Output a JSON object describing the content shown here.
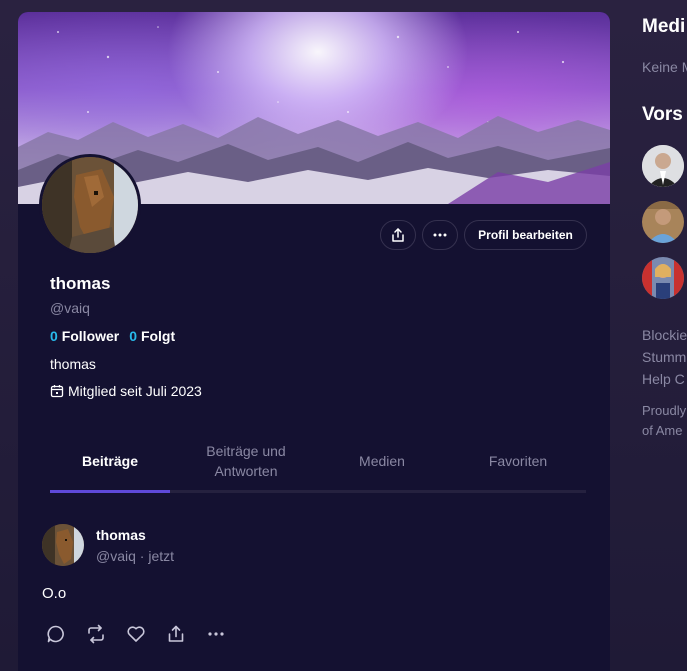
{
  "profile": {
    "name": "thomas",
    "handle": "@vaiq",
    "followers_count": "0",
    "followers_label": "Follower",
    "following_count": "0",
    "following_label": "Folgt",
    "bio": "thomas",
    "joined": "Mitglied seit Juli 2023"
  },
  "actions": {
    "edit_profile": "Profil bearbeiten",
    "share_icon": "share-icon",
    "more_icon": "more-horizontal-icon"
  },
  "tabs": [
    {
      "label": "Beiträge",
      "active": true
    },
    {
      "label": "Beiträge und Antworten",
      "active": false
    },
    {
      "label": "Medien",
      "active": false
    },
    {
      "label": "Favoriten",
      "active": false
    }
  ],
  "post": {
    "author": "thomas",
    "meta": "@vaiq · jetzt",
    "text": "O.o",
    "actions": [
      "reply-icon",
      "repost-icon",
      "like-icon",
      "share-icon",
      "more-icon"
    ]
  },
  "sidebar": {
    "media_title": "Medi",
    "media_text": "Keine M",
    "suggest_title": "Vors",
    "footer_lines": [
      "Blockie",
      "Stumm",
      "Help C"
    ],
    "footer_lines_2": [
      "Proudly",
      "of Ame"
    ]
  },
  "colors": {
    "background": "#221c3a",
    "card": "#141131",
    "accent": "#5e49d9",
    "count": "#28b9ea",
    "muted": "#8a88a3"
  }
}
